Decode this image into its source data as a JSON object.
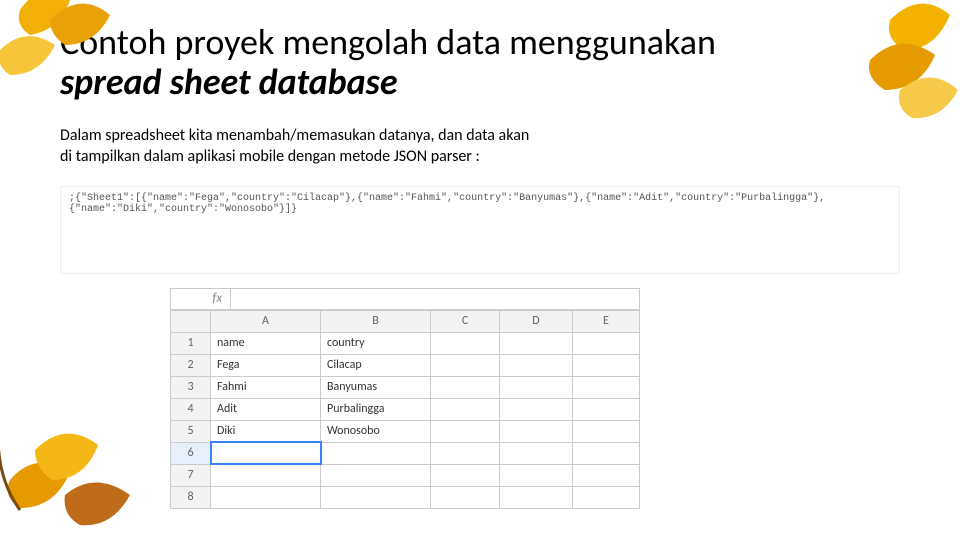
{
  "title1": "Contoh proyek mengolah data menggunakan",
  "title2": "spread sheet database",
  "description": "Dalam spreadsheet kita menambah/memasukan datanya, dan data akan di tampilkan dalam aplikasi mobile dengan metode JSON parser  :",
  "json_text": ";{\"Sheet1\":[{\"name\":\"Fega\",\"country\":\"Cilacap\"},{\"name\":\"Fahmi\",\"country\":\"Banyumas\"},{\"name\":\"Adit\",\"country\":\"Purbalingga\"},{\"name\":\"Diki\",\"country\":\"Wonosobo\"}]}",
  "fx_label": "fx",
  "fx_value": "",
  "columns": [
    "",
    "A",
    "B",
    "C",
    "D",
    "E"
  ],
  "rows": [
    {
      "n": "1",
      "a": "name",
      "b": "country"
    },
    {
      "n": "2",
      "a": "Fega",
      "b": "Cilacap"
    },
    {
      "n": "3",
      "a": "Fahmi",
      "b": "Banyumas"
    },
    {
      "n": "4",
      "a": "Adit",
      "b": "Purbalingga"
    },
    {
      "n": "5",
      "a": "Diki",
      "b": "Wonosobo"
    },
    {
      "n": "6",
      "a": "",
      "b": ""
    },
    {
      "n": "7",
      "a": "",
      "b": ""
    },
    {
      "n": "8",
      "a": "",
      "b": ""
    }
  ],
  "active_cell": {
    "row": 5,
    "col": "A"
  }
}
